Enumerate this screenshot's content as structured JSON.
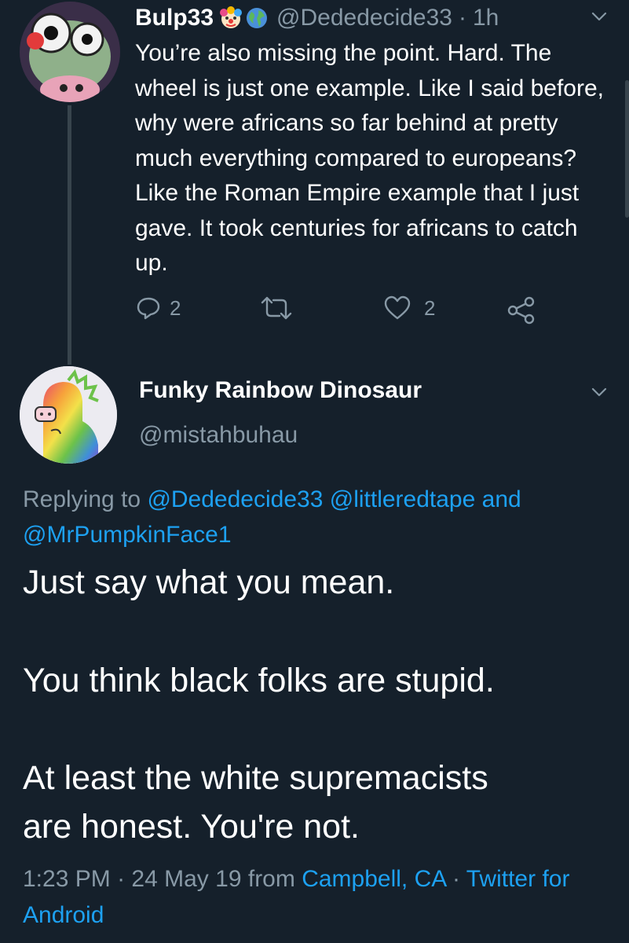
{
  "reply_tweet": {
    "display_name": "Bulp33",
    "badges": [
      "clown-face-icon",
      "globe-icon"
    ],
    "handle": "@Dededecide33",
    "time_separator": "·",
    "time": "1h",
    "text": "You’re also missing the point. Hard. The wheel is just one example. Like I said before, why were africans so far behind at pretty much everything compared to europeans? Like the Roman Empire example that I just gave. It took centuries for africans to catch up.",
    "reply_count": "2",
    "like_count": "2"
  },
  "main_tweet": {
    "display_name": "Funky Rainbow Dinosaur",
    "handle": "@mistahbuhau",
    "replying_prefix": "Replying to",
    "replying_users": [
      "@Dededecide33",
      "@littleredtape",
      "@MrPumpkinFace1"
    ],
    "replying_and": "and",
    "paragraphs": [
      "Just say what you mean.",
      "You think black folks are stupid.",
      "At least the white supremacists",
      "are honest. You're not."
    ],
    "time": "1:23 PM",
    "date": "24 May 19",
    "from_label": "from",
    "location": "Campbell, CA",
    "separator": "·",
    "source": "Twitter for Android"
  },
  "colors": {
    "background": "#15202b",
    "text": "#ffffff",
    "muted": "#8899a6",
    "link": "#1da1f2",
    "line": "#38444d"
  }
}
